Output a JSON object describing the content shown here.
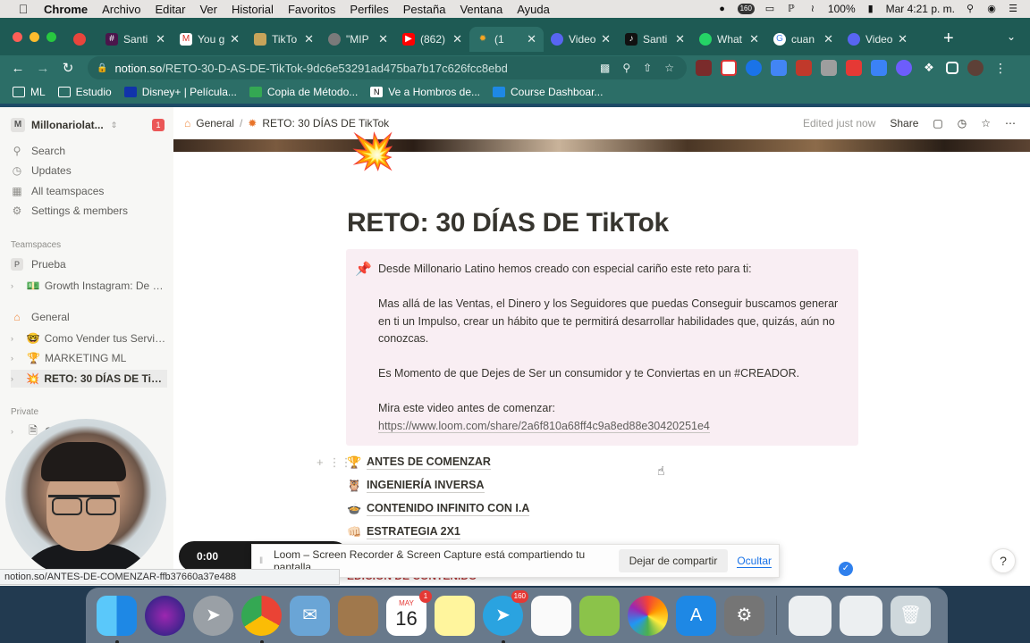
{
  "menubar": {
    "app": "Chrome",
    "menus": [
      "Archivo",
      "Editar",
      "Ver",
      "Historial",
      "Favoritos",
      "Perfiles",
      "Pestaña",
      "Ventana",
      "Ayuda"
    ],
    "badge_count": "160",
    "battery": "100%",
    "clock": "Mar 4:21 p. m."
  },
  "tabs": [
    {
      "label": "Santi",
      "color": "#e8453c"
    },
    {
      "label": "You g",
      "color": "#d93025"
    },
    {
      "label": "TikTo",
      "color": "#c8a45a"
    },
    {
      "label": "\"MIP",
      "color": "#7a7a7a"
    },
    {
      "label": "(862)",
      "color": "#ff0000"
    },
    {
      "label": "(1",
      "color": "#f6a623"
    },
    {
      "label": "Video",
      "color": "#5865f2"
    },
    {
      "label": "Santi",
      "color": "#111111"
    },
    {
      "label": "What",
      "color": "#25d366"
    },
    {
      "label": "cuan",
      "color": "#4285f4"
    },
    {
      "label": "Video",
      "color": "#5865f2"
    }
  ],
  "address": {
    "host": "notion.so",
    "path": "/RETO-30-D-AS-DE-TikTok-9dc6e53291ad475ba7b17c626fcc8ebd"
  },
  "bookmarks": [
    "ML",
    "Estudio",
    "Disney+ | Película...",
    "Copia de Método...",
    "Ve a Hombros de...",
    "Course Dashboar..."
  ],
  "sidebar": {
    "workspace": "Millonariolat...",
    "workspace_initial": "M",
    "notification_count": "1",
    "nav": [
      {
        "label": "Search",
        "icon": "search-icon"
      },
      {
        "label": "Updates",
        "icon": "clock-icon"
      },
      {
        "label": "All teamspaces",
        "icon": "grid-icon"
      },
      {
        "label": "Settings & members",
        "icon": "gear-icon"
      }
    ],
    "teamspaces_heading": "Teamspaces",
    "teamspace_prueba": {
      "initial": "P",
      "label": "Prueba"
    },
    "teamspace_growth": "Growth Instagram: De C...",
    "general": "General",
    "pages": [
      {
        "emoji": "🤓",
        "label": "Como Vender tus Servici..."
      },
      {
        "emoji": "🏆",
        "label": "MARKETING ML"
      },
      {
        "emoji": "💥",
        "label": "RETO: 30 DÍAS DE TikTok"
      }
    ],
    "private_heading": "Private",
    "private_page_visible": "C"
  },
  "topbar": {
    "crumb_general": "General",
    "crumb_page": "RETO: 30 DÍAS DE TikTok",
    "edited": "Edited just now",
    "share": "Share"
  },
  "page": {
    "icon": "💥",
    "title": "RETO: 30 DÍAS DE TikTok",
    "callout": {
      "icon": "📌",
      "line1": "Desde Millonario Latino hemos creado con especial cariño este reto para ti:",
      "para2": "Mas allá de las Ventas, el Dinero y los Seguidores que puedas Conseguir buscamos generar en ti un Impulso, crear un hábito que te permitirá desarrollar habilidades que, quizás, aún no conozcas.",
      "para3": "Es Momento de que Dejes de Ser un consumidor y te Conviertas en un #CREADOR.",
      "para4": "Mira este video antes de comenzar:",
      "link": "https://www.loom.com/share/2a6f810a68ff4c9a8ed88e30420251e4"
    },
    "items": [
      {
        "emoji": "🏆",
        "label": "ANTES DE COMENZAR"
      },
      {
        "emoji": "🦉",
        "label": "INGENIERÍA INVERSA"
      },
      {
        "emoji": "🍲",
        "label": "CONTENIDO INFINITO CON I.A"
      },
      {
        "emoji": "👊🏻",
        "label": "ESTRATEGIA 2X1"
      }
    ],
    "partial_item": "EDICIÓN DE CONTENIDO"
  },
  "overlay": {
    "timer": "0:00",
    "loom_message": "Loom – Screen Recorder & Screen Capture está compartiendo tu pantalla.",
    "stop_sharing": "Dejar de compartir",
    "hide": "Ocultar",
    "help": "?",
    "status_url": "notion.so/ANTES-DE-COMENZAR-ffb37660a37e488"
  },
  "dock": {
    "calendar_month": "MAY",
    "calendar_day": "16",
    "calendar_badge": "1",
    "telegram_badge": "160"
  }
}
